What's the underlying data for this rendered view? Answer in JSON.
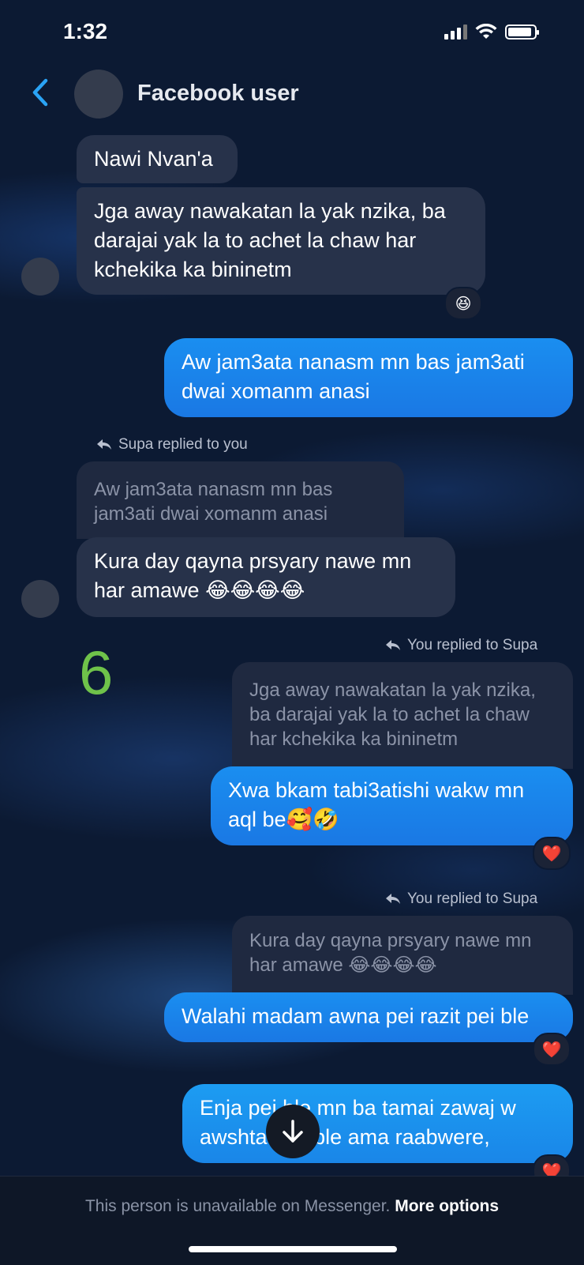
{
  "status_bar": {
    "time": "1:32"
  },
  "header": {
    "contact_name": "Facebook user"
  },
  "messages": {
    "m1": {
      "text": "Nawi Nvan'a"
    },
    "m2": {
      "text": "Jga away nawakatan la yak nzika, ba darajai yak la to achet la chaw har kchekika ka bininetm",
      "reaction": "😆"
    },
    "m3": {
      "text": "Aw jam3ata nanasm mn bas jam3ati dwai xomanm anasi"
    },
    "m4": {
      "reply_label": "Supa replied to you",
      "quoted": "Aw jam3ata nanasm mn bas jam3ati dwai xomanm anasi",
      "text": "Kura day qayna prsyary nawe mn har amawe 😂😂😂😂"
    },
    "m5": {
      "reply_label": "You replied to Supa",
      "quoted": "Jga away nawakatan la yak nzika, ba darajai yak la to achet la chaw har kchekika ka bininetm",
      "text": "Xwa bkam tabi3atishi wakw mn aql be🥰🤣",
      "reaction": "❤️"
    },
    "m6": {
      "reply_label": "You replied to Supa",
      "quoted": "Kura day qayna prsyary nawe mn har amawe 😂😂😂😂",
      "text": "Walahi madam awna pei razit pei ble",
      "reaction": "❤️"
    },
    "m7": {
      "text": "Enja pei ble mn ba tamai zawaj w awshta nak ble ama raabwere,",
      "reaction": "❤️"
    }
  },
  "overlay_number": "6",
  "footer": {
    "notice": "This person is unavailable on Messenger.",
    "link": "More options"
  },
  "colors": {
    "background": "#0c1a33",
    "outgoing_bubble": "#1a82ea",
    "incoming_bubble": "#27324a",
    "accent": "#2aa3f5",
    "overlay_number": "#6fc24a"
  },
  "icons": [
    "signal-icon",
    "wifi-icon",
    "battery-icon",
    "back-chevron-icon",
    "reply-arrow-icon",
    "arrow-down-icon"
  ]
}
